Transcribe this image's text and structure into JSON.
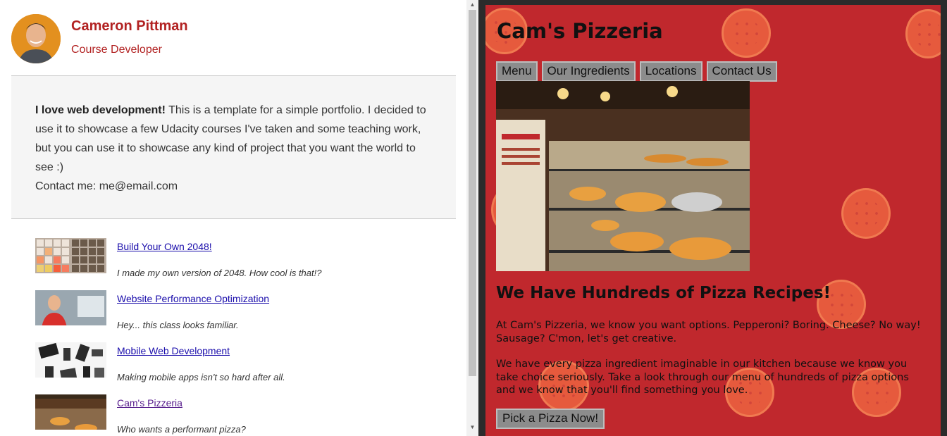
{
  "profile": {
    "name": "Cameron Pittman",
    "role": "Course Developer"
  },
  "about": {
    "bold": "I love web development!",
    "text": " This is a template for a simple portfolio. I decided to use it to showcase a few Udacity courses I've taken and some teaching work, but you can use it to showcase any kind of project that you want the world to see :)",
    "contact": "Contact me: me@email.com"
  },
  "projects": [
    {
      "title": "Build Your Own 2048!",
      "description": "I made my own version of 2048. How cool is that!?"
    },
    {
      "title": "Website Performance Optimization",
      "description": "Hey... this class looks familiar."
    },
    {
      "title": "Mobile Web Development",
      "description": "Making mobile apps isn't so hard after all."
    },
    {
      "title": "Cam's Pizzeria",
      "description": "Who wants a performant pizza?"
    }
  ],
  "pizzeria": {
    "title": "Cam's Pizzeria",
    "nav": [
      "Menu",
      "Our Ingredients",
      "Locations",
      "Contact Us"
    ],
    "headline": "We Have Hundreds of Pizza Recipes!",
    "para1": "At Cam's Pizzeria, we know you want options. Pepperoni? Boring. Cheese? No way! Sausage? C'mon, let's get creative.",
    "para2": "We have every pizza ingredient imaginable in our kitchen because we know you take choice seriously. Take a look through our menu of hundreds of pizza options and we know that you'll find something you love.",
    "cta": "Pick a Pizza Now!"
  },
  "colors": {
    "accent": "#b22222",
    "pizzeria_bg": "#c0282d",
    "link": "#1a0dab",
    "visited_link": "#551a8b"
  }
}
